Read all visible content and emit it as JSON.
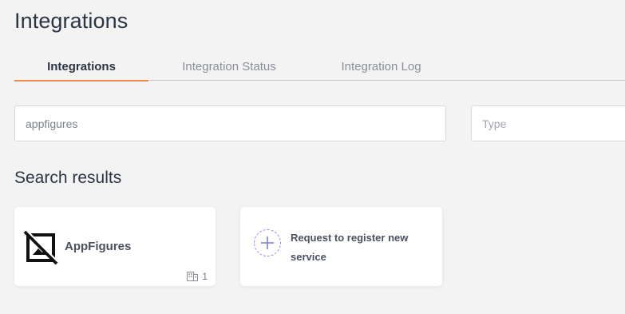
{
  "page": {
    "title": "Integrations"
  },
  "tabs": [
    {
      "label": "Integrations",
      "active": true
    },
    {
      "label": "Integration Status",
      "active": false
    },
    {
      "label": "Integration Log",
      "active": false
    }
  ],
  "filters": {
    "search_value": "appfigures",
    "type_placeholder": "Type"
  },
  "results": {
    "heading": "Search results",
    "items": [
      {
        "name": "AppFigures",
        "icon": "image-unavailable-icon",
        "org_count": "1"
      }
    ],
    "request_card": {
      "label": "Request to register new service",
      "icon": "plus-icon"
    }
  },
  "colors": {
    "accent": "#ef8a4a",
    "plus": "#7b7ee8"
  }
}
